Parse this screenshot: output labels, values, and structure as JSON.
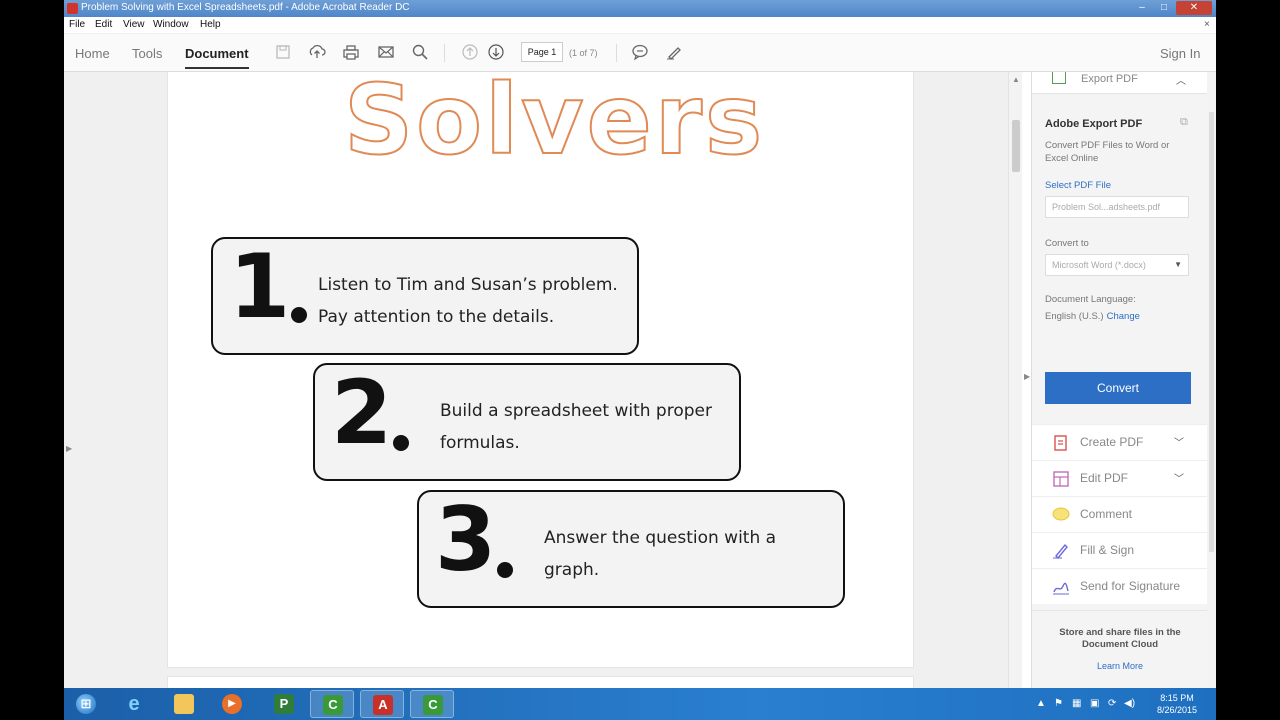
{
  "window": {
    "title": "Problem Solving with Excel Spreadsheets.pdf - Adobe Acrobat Reader DC",
    "min": "–",
    "max": "□",
    "close": "✕"
  },
  "menu": {
    "items": [
      "File",
      "Edit",
      "View",
      "Window",
      "Help"
    ],
    "close_doc": "×"
  },
  "toolbar": {
    "tabs": {
      "home": "Home",
      "tools": "Tools",
      "document": "Document"
    },
    "page_label": "Page 1",
    "page_count": "(1 of 7)",
    "sign_in": "Sign In",
    "icons": [
      "save-icon",
      "upload-icon",
      "print-icon",
      "email-icon",
      "search-icon",
      "prev-page-icon",
      "next-page-icon",
      "comment-icon",
      "sign-pen-icon"
    ]
  },
  "document": {
    "heading": "Solvers",
    "steps": [
      {
        "number": "1",
        "line1": "Listen to Tim and Susan’s problem.",
        "line2": "Pay attention to the details."
      },
      {
        "number": "2",
        "line1": "Build a spreadsheet with proper",
        "line2": "formulas."
      },
      {
        "number": "3",
        "line1": "Answer the question with a",
        "line2": "graph."
      }
    ]
  },
  "right_panel": {
    "export_header": "Export PDF",
    "export_title": "Adobe Export PDF",
    "export_desc": "Convert PDF Files to Word or Excel Online",
    "select_file": "Select PDF File",
    "file_name": "Problem Sol...adsheets.pdf",
    "convert_to": "Convert to",
    "format": "Microsoft Word (*.docx)",
    "doc_language_label": "Document Language:",
    "doc_language": "English (U.S.)",
    "change": "Change",
    "convert_button": "Convert",
    "tools": [
      {
        "label": "Create PDF",
        "icon": "create-pdf-icon",
        "color": "#d9534f"
      },
      {
        "label": "Edit PDF",
        "icon": "edit-pdf-icon",
        "color": "#c46db8"
      },
      {
        "label": "Comment",
        "icon": "comment-bubble-icon",
        "color": "#f2d34b"
      },
      {
        "label": "Fill & Sign",
        "icon": "fill-sign-icon",
        "color": "#6a6ad8"
      },
      {
        "label": "Send for Signature",
        "icon": "send-signature-icon",
        "color": "#6a6ad8"
      }
    ],
    "cloud_text": "Store and share files in the Document Cloud",
    "learn_more": "Learn More"
  },
  "taskbar": {
    "apps": [
      "start-icon",
      "internet-explorer-icon",
      "file-explorer-icon",
      "media-player-icon",
      "project-icon",
      "camtasia-icon",
      "acrobat-icon",
      "camtasia-recorder-icon"
    ],
    "time": "8:15 PM",
    "date": "8/26/2015"
  },
  "colors": {
    "accent": "#2d6fc4",
    "solvers_outline": "#e08a55",
    "taskbar": "#1e6fc0"
  }
}
